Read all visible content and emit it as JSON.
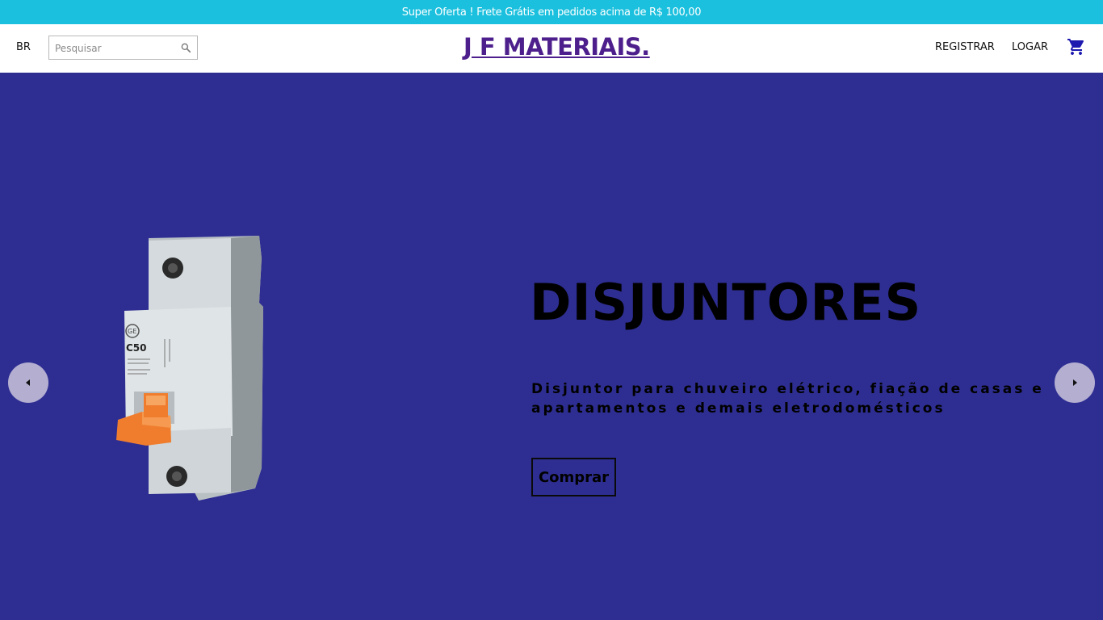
{
  "announcement": {
    "text": "Super Oferta ! Frete Grátis em pedidos acima de R$ 100,00"
  },
  "header": {
    "language": "BR",
    "search": {
      "placeholder": "Pesquisar",
      "value": "",
      "icon": "search-icon"
    },
    "logo": "J F MATERIAIS.",
    "nav": {
      "register": "REGISTRAR",
      "login": "LOGAR"
    },
    "cart_icon": "cart-icon"
  },
  "hero": {
    "title": "DISJUNTORES",
    "description": "Disjuntor para chuveiro elétrico, fiação de casas e apartamentos e demais eletrodomésticos",
    "button": "Comprar",
    "product_label": "C50",
    "product_brand": "GE",
    "arrows": {
      "prev_icon": "arrow-left-icon",
      "next_icon": "arrow-right-icon"
    }
  },
  "colors": {
    "announcement_bg": "#1bc0de",
    "logo": "#4d1f8c",
    "hero_bg": "#2e2e92",
    "arrow_bg": "#b4aed0",
    "cart": "#1e1ab0"
  }
}
